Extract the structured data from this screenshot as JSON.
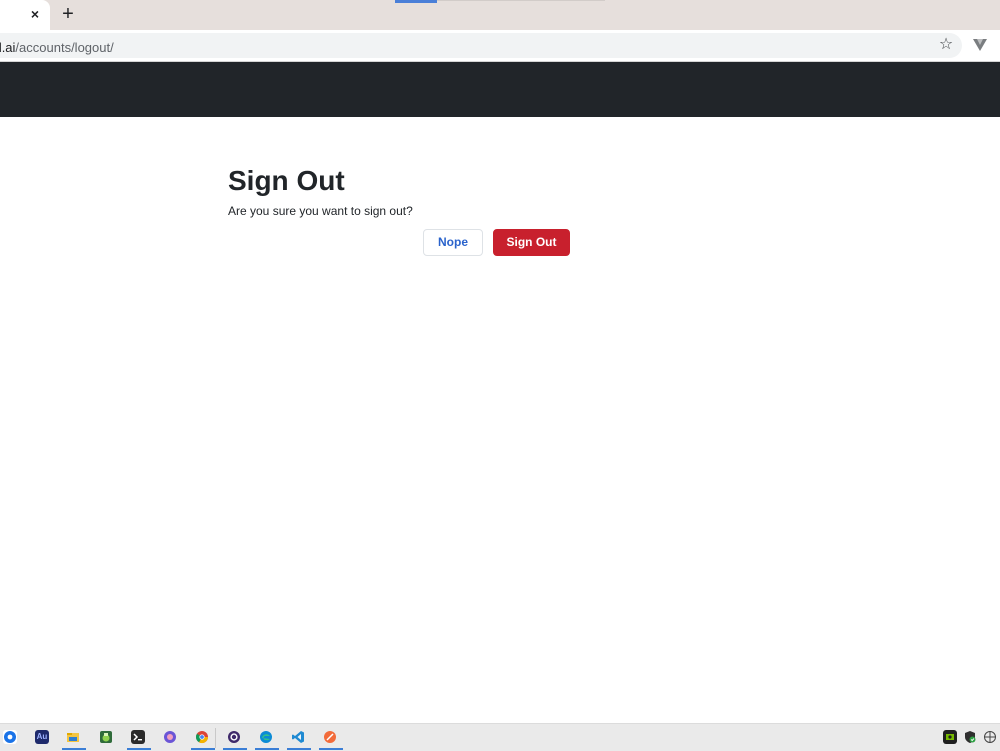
{
  "browser": {
    "tab": {
      "close_glyph": "×"
    },
    "new_tab_glyph": "+",
    "address": {
      "domain": "nad.ai",
      "path": "/accounts/logout/"
    },
    "bookmark_glyph": "☆"
  },
  "page": {
    "title": "Sign Out",
    "message": "Are you sure you want to sign out?",
    "nope_label": "Nope",
    "signout_label": "Sign Out"
  },
  "taskbar": {
    "apps": [
      {
        "name": "location-icon"
      },
      {
        "name": "audition-icon",
        "label": "Au"
      },
      {
        "name": "file-explorer-icon"
      },
      {
        "name": "android-studio-icon"
      },
      {
        "name": "terminal-icon"
      },
      {
        "name": "app-circle-icon"
      },
      {
        "name": "chrome-icon"
      },
      {
        "name": "obs-icon"
      },
      {
        "name": "edge-icon"
      },
      {
        "name": "vscode-icon"
      },
      {
        "name": "postman-icon"
      }
    ],
    "tray": [
      {
        "name": "nvidia-icon"
      },
      {
        "name": "security-shield-icon"
      },
      {
        "name": "network-icon"
      }
    ]
  },
  "colors": {
    "navbar": "#212529",
    "danger": "#c8202d",
    "link": "#2a63cc"
  }
}
